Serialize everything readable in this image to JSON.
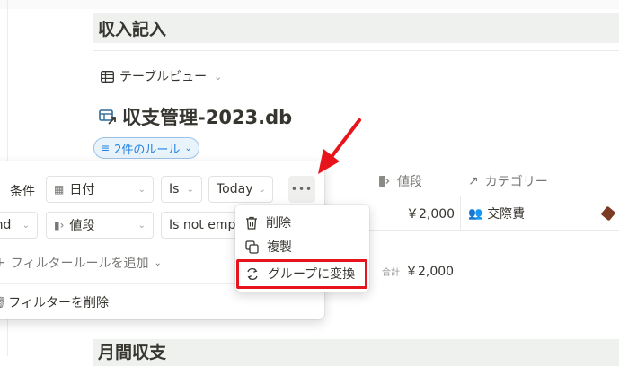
{
  "section": {
    "title": "収入記入"
  },
  "view_tab": {
    "label": "テーブルビュー"
  },
  "database": {
    "title": "収支管理-2023.db"
  },
  "filter_chip": {
    "label": "2件のルール"
  },
  "columns": [
    {
      "label": "値段",
      "icon": "number-icon"
    },
    {
      "label": "カテゴリー",
      "icon": "relation-arrow-icon"
    }
  ],
  "row": {
    "price": "￥2,000",
    "category": "交際費"
  },
  "summary": {
    "label": "合計",
    "value": "￥2,000"
  },
  "filter_panel": {
    "row1": {
      "label": "条件",
      "property": "日付",
      "operator": "Is",
      "value": "Today"
    },
    "row2": {
      "conjunction": "And",
      "property": "値段",
      "operator": "Is not empty"
    },
    "add_rule": "フィルタールールを追加",
    "delete_filter": "フィルターを削除"
  },
  "context_menu": {
    "items": [
      {
        "label": "削除",
        "icon": "trash-icon"
      },
      {
        "label": "複製",
        "icon": "duplicate-icon"
      },
      {
        "label": "グループに変換",
        "icon": "convert-icon"
      }
    ]
  },
  "next_section": {
    "title": "月間収支"
  },
  "colors": {
    "highlight": "#e8141b",
    "arrow": "#e8141b",
    "accent": "#2383e2",
    "section_bg": "#eef1ee"
  }
}
